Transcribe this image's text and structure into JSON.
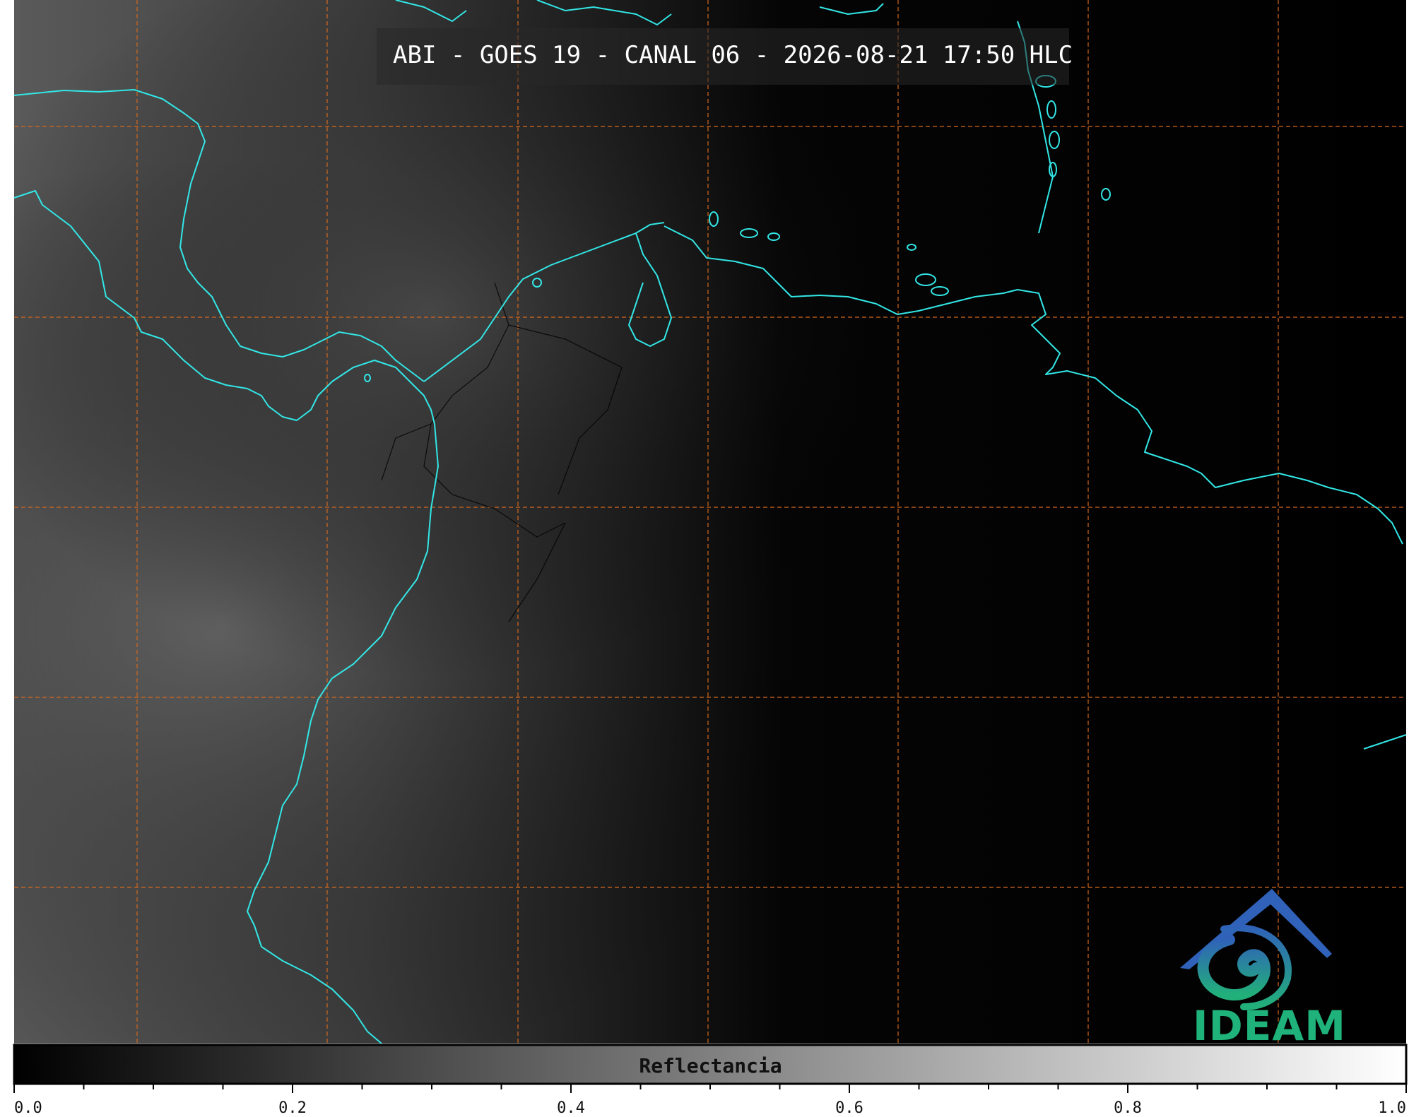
{
  "header": {
    "title": "ABI - GOES 19 - CANAL 06 - 2026-08-21 17:50 HLC"
  },
  "colorbar": {
    "label": "Reflectancia",
    "min": 0.0,
    "max": 1.0,
    "major_ticks": [
      "0.0",
      "0.2",
      "0.4",
      "0.6",
      "0.8",
      "1.0"
    ],
    "colormap": "grayscale"
  },
  "map": {
    "colors": {
      "coastline": "#33e6e6",
      "gridline": "#d2691e",
      "borders": "#000000",
      "background": "#000000"
    },
    "gridline_style": "dashed"
  },
  "logo": {
    "text": "IDEAM",
    "color": "#1fb27a",
    "icon": "ideam-swirl-logo-icon"
  }
}
